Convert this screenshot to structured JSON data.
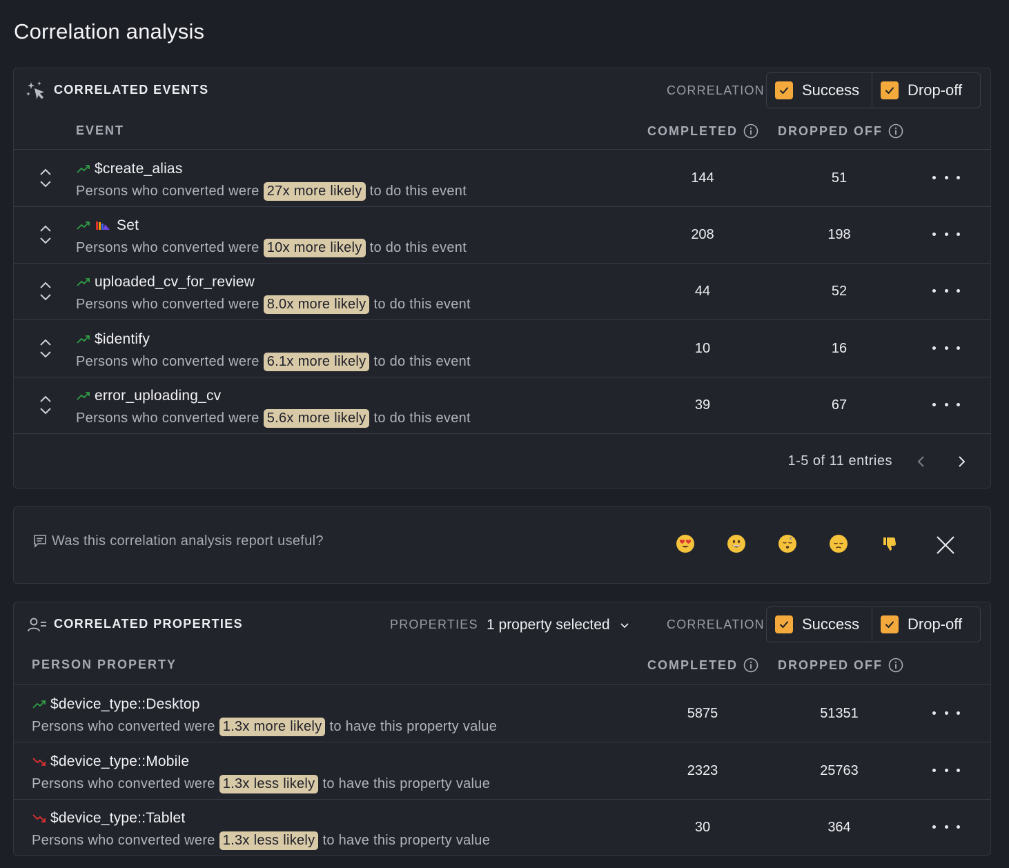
{
  "page": {
    "title": "Correlation analysis"
  },
  "events_card": {
    "title": "CORRELATED EVENTS",
    "correlation_label": "CORRELATION",
    "toggles": {
      "success": "Success",
      "dropoff": "Drop-off"
    },
    "columns": {
      "event": "EVENT",
      "completed": "COMPLETED",
      "dropped_off": "DROPPED OFF"
    },
    "rows": [
      {
        "name": "$create_alias",
        "prefix": "Persons who converted were",
        "badge": "27x more likely",
        "suffix": "to do this event",
        "completed": "144",
        "dropped": "51",
        "trend": "up"
      },
      {
        "name": "Set",
        "prefix": "Persons who converted were",
        "badge": "10x more likely",
        "suffix": "to do this event",
        "completed": "208",
        "dropped": "198",
        "trend": "up"
      },
      {
        "name": "uploaded_cv_for_review",
        "prefix": "Persons who converted were",
        "badge": "8.0x more likely",
        "suffix": "to do this event",
        "completed": "44",
        "dropped": "52",
        "trend": "up"
      },
      {
        "name": "$identify",
        "prefix": "Persons who converted were",
        "badge": "6.1x more likely",
        "suffix": "to do this event",
        "completed": "10",
        "dropped": "16",
        "trend": "up"
      },
      {
        "name": "error_uploading_cv",
        "prefix": "Persons who converted were",
        "badge": "5.6x more likely",
        "suffix": "to do this event",
        "completed": "39",
        "dropped": "67",
        "trend": "up"
      }
    ],
    "pagination": "1-5 of 11 entries"
  },
  "feedback": {
    "question": "Was this correlation analysis report useful?",
    "emojis": [
      "heart-eyes",
      "grinning",
      "sleeping",
      "pensive",
      "thumbs-down"
    ]
  },
  "properties_card": {
    "title": "CORRELATED PROPERTIES",
    "properties_label": "PROPERTIES",
    "properties_value": "1 property selected",
    "correlation_label": "CORRELATION",
    "toggles": {
      "success": "Success",
      "dropoff": "Drop-off"
    },
    "columns": {
      "property": "PERSON PROPERTY",
      "completed": "COMPLETED",
      "dropped_off": "DROPPED OFF"
    },
    "rows": [
      {
        "name": "$device_type::Desktop",
        "prefix": "Persons who converted were",
        "badge": "1.3x more likely",
        "suffix": "to have this property value",
        "completed": "5875",
        "dropped": "51351",
        "trend": "up"
      },
      {
        "name": "$device_type::Mobile",
        "prefix": "Persons who converted were",
        "badge": "1.3x less likely",
        "suffix": "to have this property value",
        "completed": "2323",
        "dropped": "25763",
        "trend": "down"
      },
      {
        "name": "$device_type::Tablet",
        "prefix": "Persons who converted were",
        "badge": "1.3x less likely",
        "suffix": "to have this property value",
        "completed": "30",
        "dropped": "364",
        "trend": "down"
      }
    ]
  },
  "colors": {
    "background": "#1d1f27",
    "card": "#22242c",
    "accent_checkbox": "#f3a93c",
    "badge": "#d8c9a7",
    "trend_up": "#2f9e44",
    "trend_down": "#e03131"
  }
}
